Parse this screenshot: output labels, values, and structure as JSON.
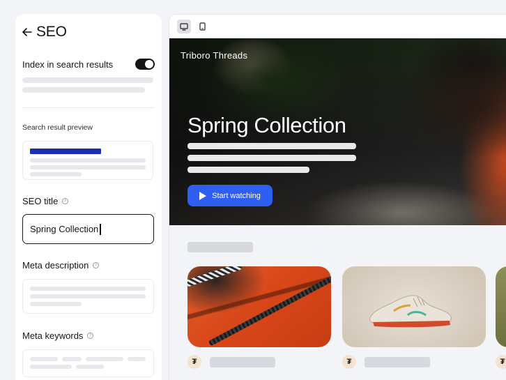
{
  "panel": {
    "title": "SEO",
    "index_label": "Index in search results",
    "index_enabled": true,
    "preview_label": "Search result preview",
    "seo_title_label": "SEO title",
    "seo_title_value": "Spring Collection",
    "meta_description_label": "Meta description",
    "meta_keywords_label": "Meta keywords"
  },
  "preview": {
    "brand": "Triboro Threads",
    "hero_title": "Spring Collection",
    "cta_label": "Start watching",
    "meta_avatar_glyph": "₮"
  },
  "colors": {
    "accent": "#2e5ff0",
    "preview_link": "#1c2fae",
    "toggle_on": "#161616"
  }
}
